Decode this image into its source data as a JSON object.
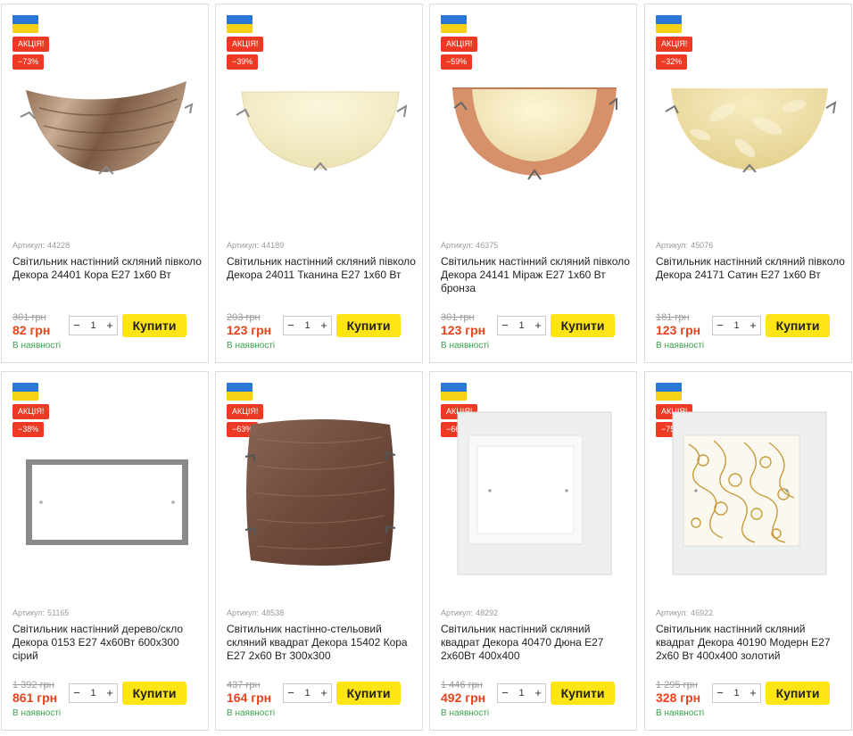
{
  "products": [
    {
      "badge_sale": "АКЦІЯ!",
      "discount": "−73%",
      "sku_label": "Артикул:",
      "sku": "44228",
      "title": "Світильник настінний скляний півколо Декора 24401 Кора Е27 1х60 Вт",
      "old_price": "301 грн",
      "price": "82 грн",
      "qty": "1",
      "buy_label": "Купити",
      "stock": "В наявності",
      "image_icon": "halfmoon-brown-lamp-icon"
    },
    {
      "badge_sale": "АКЦІЯ!",
      "discount": "−39%",
      "sku_label": "Артикул:",
      "sku": "44189",
      "title": "Світильник настінний скляний півколо Декора 24011 Тканина Е27 1х60 Вт",
      "old_price": "203 грн",
      "price": "123 грн",
      "qty": "1",
      "buy_label": "Купити",
      "stock": "В наявності",
      "image_icon": "halfmoon-cream-lamp-icon"
    },
    {
      "badge_sale": "АКЦІЯ!",
      "discount": "−59%",
      "sku_label": "Артикул:",
      "sku": "46375",
      "title": "Світильник настінний скляний півколо Декора 24141 Міраж Е27 1х60 Вт бронза",
      "old_price": "301 грн",
      "price": "123 грн",
      "qty": "1",
      "buy_label": "Купити",
      "stock": "В наявності",
      "image_icon": "halfmoon-bronze-lamp-icon"
    },
    {
      "badge_sale": "АКЦІЯ!",
      "discount": "−32%",
      "sku_label": "Артикул:",
      "sku": "45076",
      "title": "Світильник настінний скляний півколо Декора 24171 Сатин Е27 1х60 Вт",
      "old_price": "181 грн",
      "price": "123 грн",
      "qty": "1",
      "buy_label": "Купити",
      "stock": "В наявності",
      "image_icon": "halfmoon-satin-lamp-icon"
    },
    {
      "badge_sale": "АКЦІЯ!",
      "discount": "−38%",
      "sku_label": "Артикул:",
      "sku": "51165",
      "title": "Світильник настінний дерево/скло Декора 0153 Е27 4х60Вт 600х300 сірий",
      "old_price": "1 392 грн",
      "price": "861 грн",
      "qty": "1",
      "buy_label": "Купити",
      "stock": "В наявності",
      "image_icon": "rect-wood-lamp-icon"
    },
    {
      "badge_sale": "АКЦІЯ!",
      "discount": "−63%",
      "sku_label": "Артикул:",
      "sku": "48538",
      "title": "Світильник настінно-стельовий скляний квадрат Декора 15402 Кора Е27 2х60 Вт 300х300",
      "old_price": "437 грн",
      "price": "164 грн",
      "qty": "1",
      "buy_label": "Купити",
      "stock": "В наявності",
      "image_icon": "square-brown-lamp-icon"
    },
    {
      "badge_sale": "АКЦІЯ!",
      "discount": "−66%",
      "sku_label": "Артикул:",
      "sku": "48292",
      "title": "Світильник настінний скляний квадрат Декора 40470 Дюна Е27 2х60Вт 400х400",
      "old_price": "1 446 грн",
      "price": "492 грн",
      "qty": "1",
      "buy_label": "Купити",
      "stock": "В наявності",
      "image_icon": "square-white-lamp-icon"
    },
    {
      "badge_sale": "АКЦІЯ!",
      "discount": "−75%",
      "sku_label": "Артикул:",
      "sku": "46922",
      "title": "Світильник настінний скляний квадрат Декора 40190 Модерн Е27 2х60 Вт 400х400 золотий",
      "old_price": "1 295 грн",
      "price": "328 грн",
      "qty": "1",
      "buy_label": "Купити",
      "stock": "В наявності",
      "image_icon": "square-gold-lamp-icon"
    }
  ],
  "colors": {
    "sale_badge": "#ee3a24",
    "price": "#e8431b",
    "stock": "#3aa14c",
    "buy_button": "#ffe516",
    "flag_blue": "#2b77d6",
    "flag_yellow": "#f7d117"
  }
}
